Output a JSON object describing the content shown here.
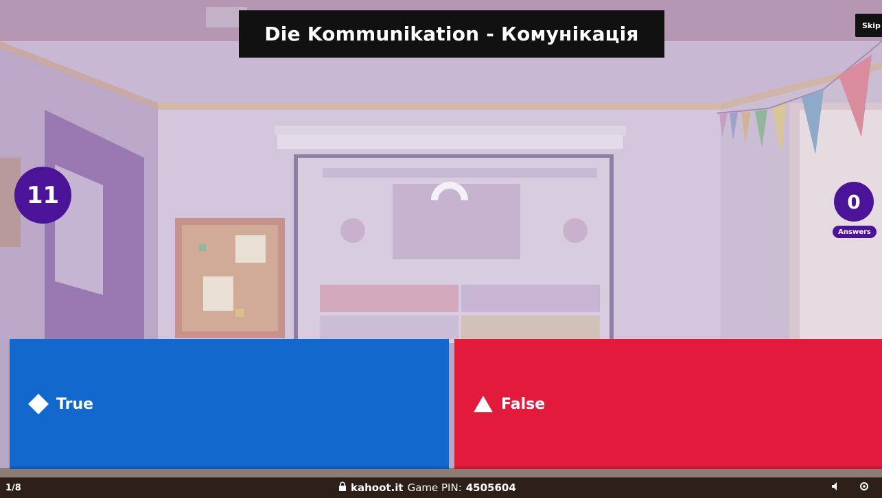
{
  "header": {
    "title": "Die Kommunikation - Комунікація",
    "skip_label": "Skip"
  },
  "timer": {
    "value": "11"
  },
  "answers": {
    "count": "0",
    "label": "Answers"
  },
  "options": [
    {
      "label": "True",
      "color": "#1368ce",
      "shape": "diamond-icon"
    },
    {
      "label": "False",
      "color": "#e21b3c",
      "shape": "triangle-icon"
    }
  ],
  "footer": {
    "progress": "1/8",
    "domain": "kahoot.it",
    "pin_label": "Game PIN:",
    "pin_value": "4505604"
  }
}
